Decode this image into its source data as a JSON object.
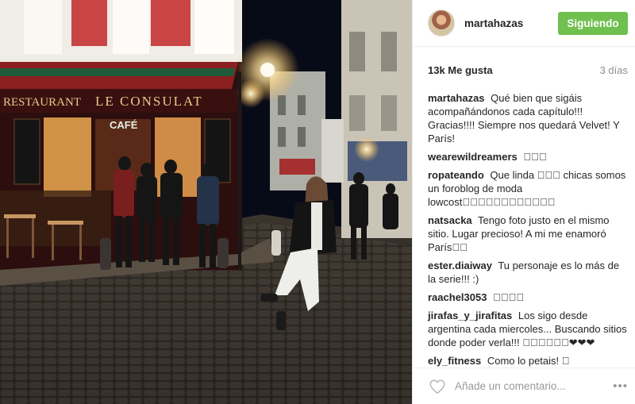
{
  "post": {
    "username": "martahazas",
    "follow_label": "Siguiendo",
    "likes": "13k Me gusta",
    "age": "3 días"
  },
  "photo": {
    "sign_restaurant": "RESTAURANT",
    "sign_name": "LE CONSULAT",
    "sign_cafe": "CAFÉ"
  },
  "comments": [
    {
      "user": "martahazas",
      "text": "Qué bien que sigáis acompañándonos cada capítulo!!! Gracias!!!! Siempre nos quedará Velvet! Y París!"
    },
    {
      "user": "wearewildreamers",
      "text": "⃞⃞⃞"
    },
    {
      "user": "ropateando",
      "text": "Que linda ⃞⃞⃞ chicas somos un foroblog de moda lowcost⃞⃞⃞⃞⃞⃞⃞⃞⃞⃞⃞⃞"
    },
    {
      "user": "natsacka",
      "text": "Tengo foto justo en el mismo sitio. Lugar precioso! A mi me enamoró París⃞⃞"
    },
    {
      "user": "ester.diaiway",
      "text": "Tu personaje es lo más de la serie!!! :)"
    },
    {
      "user": "raachel3053",
      "text": "⃞⃞⃞⃞"
    },
    {
      "user": "jirafas_y_jirafitas",
      "text": "Los sigo desde argentina cada miercoles... Buscando sitios donde poder verla!!! ⃞⃞⃞⃞⃞⃞❤❤❤"
    },
    {
      "user": "ely_fitness",
      "text": "Como lo petais! ⃞"
    },
    {
      "user": "",
      "text": ""
    }
  ],
  "footer": {
    "comment_placeholder": "Añade un comentario...",
    "more_label": "•••"
  },
  "colors": {
    "follow_button": "#70c050",
    "border": "#efefef",
    "muted": "#8e8e8e"
  },
  "icons": {
    "like": "heart-icon",
    "options": "more-options-icon"
  }
}
